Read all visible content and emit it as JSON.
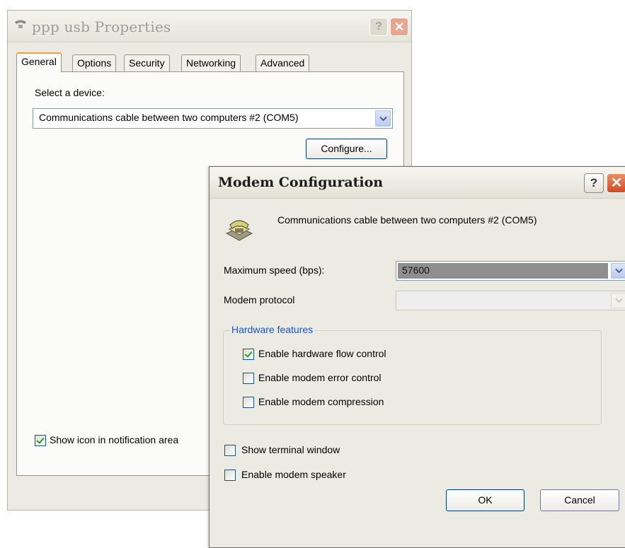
{
  "back_dialog": {
    "title": "ppp usb Properties",
    "tabs": [
      {
        "label": "General",
        "active": true
      },
      {
        "label": "Options",
        "active": false
      },
      {
        "label": "Security",
        "active": false
      },
      {
        "label": "Networking",
        "active": false
      },
      {
        "label": "Advanced",
        "active": false
      }
    ],
    "select_device_label": "Select a device:",
    "device_value": "Communications cable between two computers #2 (COM5)",
    "configure_label": "Configure...",
    "show_icon_label": "Show icon in notification area",
    "show_icon_checked": true
  },
  "front_dialog": {
    "title": "Modem Configuration",
    "device_name": "Communications cable between two computers #2 (COM5)",
    "max_speed_label": "Maximum speed (bps):",
    "max_speed_value": "57600",
    "protocol_label": "Modem protocol",
    "protocol_value": "",
    "hardware_group_title": "Hardware features",
    "hardware_options": [
      {
        "label": "Enable hardware flow control",
        "checked": true
      },
      {
        "label": "Enable modem error control",
        "checked": false
      },
      {
        "label": "Enable modem compression",
        "checked": false
      }
    ],
    "show_terminal_label": "Show terminal window",
    "show_terminal_checked": false,
    "modem_speaker_label": "Enable modem speaker",
    "modem_speaker_checked": false,
    "ok_label": "OK",
    "cancel_label": "Cancel"
  },
  "titlebar_buttons": {
    "help": "?",
    "close": "✕"
  },
  "icons": {
    "app": "phone-handset-icon",
    "modem": "telephone-icon",
    "dropdown": "chevron-down-icon",
    "check": "checkmark-icon"
  },
  "colors": {
    "dialog_bg": "#ecebe3",
    "tab_highlight": "#e8a33d",
    "group_title": "#1a52c8",
    "close_button": "#cf4a24",
    "checkmark": "#21a121",
    "selected_fill": "#8f8f8f"
  }
}
